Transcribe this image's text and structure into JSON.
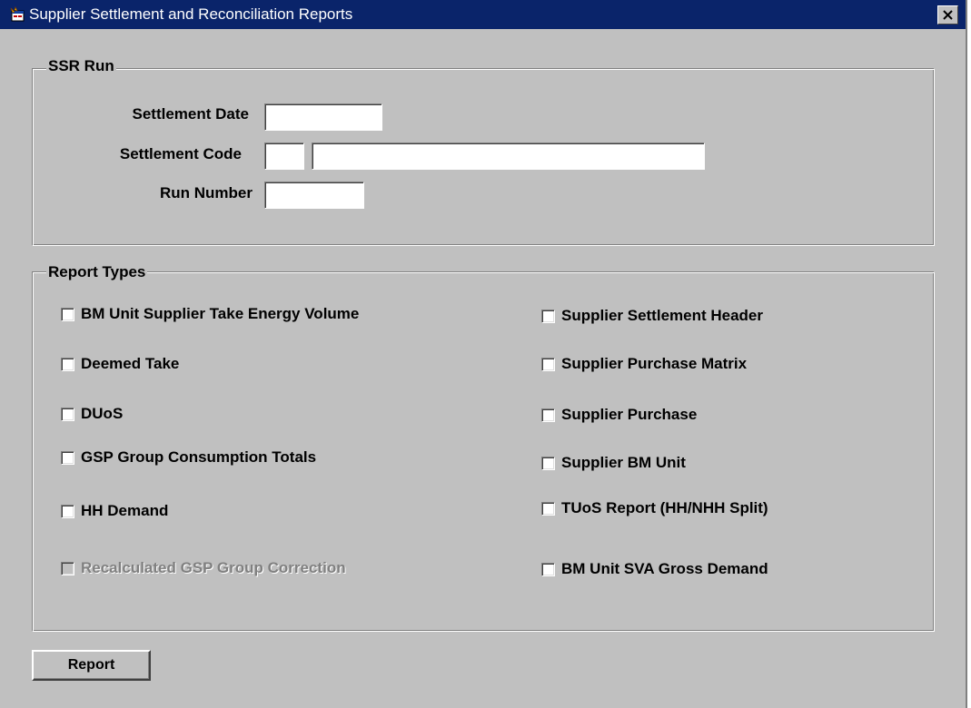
{
  "window": {
    "title": "Supplier Settlement and Reconciliation Reports",
    "icon": "application-icon",
    "close_icon": "close-icon"
  },
  "ssr_run": {
    "legend": "SSR Run",
    "settlement_date": {
      "label": "Settlement Date",
      "value": ""
    },
    "settlement_code": {
      "label": "Settlement Code",
      "code_value": "",
      "description_value": ""
    },
    "run_number": {
      "label": "Run Number",
      "value": ""
    }
  },
  "report_types": {
    "legend": "Report Types",
    "left": [
      {
        "label": "BM Unit Supplier Take Energy Volume",
        "checked": false,
        "enabled": true
      },
      {
        "label": "Deemed Take",
        "checked": false,
        "enabled": true
      },
      {
        "label": "DUoS",
        "checked": false,
        "enabled": true
      },
      {
        "label": "GSP Group Consumption Totals",
        "checked": false,
        "enabled": true
      },
      {
        "label": "HH Demand",
        "checked": false,
        "enabled": true
      },
      {
        "label": "Recalculated GSP Group Correction",
        "checked": false,
        "enabled": false
      }
    ],
    "right": [
      {
        "label": "Supplier Settlement Header",
        "checked": false,
        "enabled": true
      },
      {
        "label": "Supplier Purchase Matrix",
        "checked": false,
        "enabled": true
      },
      {
        "label": "Supplier Purchase",
        "checked": false,
        "enabled": true
      },
      {
        "label": "Supplier BM Unit",
        "checked": false,
        "enabled": true
      },
      {
        "label": "TUoS Report (HH/NHH Split)",
        "checked": false,
        "enabled": true
      },
      {
        "label": "BM Unit SVA Gross Demand",
        "checked": false,
        "enabled": true
      }
    ]
  },
  "actions": {
    "report_label": "Report"
  },
  "colors": {
    "titlebar": "#0a246a",
    "background": "#c0c0c0",
    "disabled_text": "#808080"
  }
}
